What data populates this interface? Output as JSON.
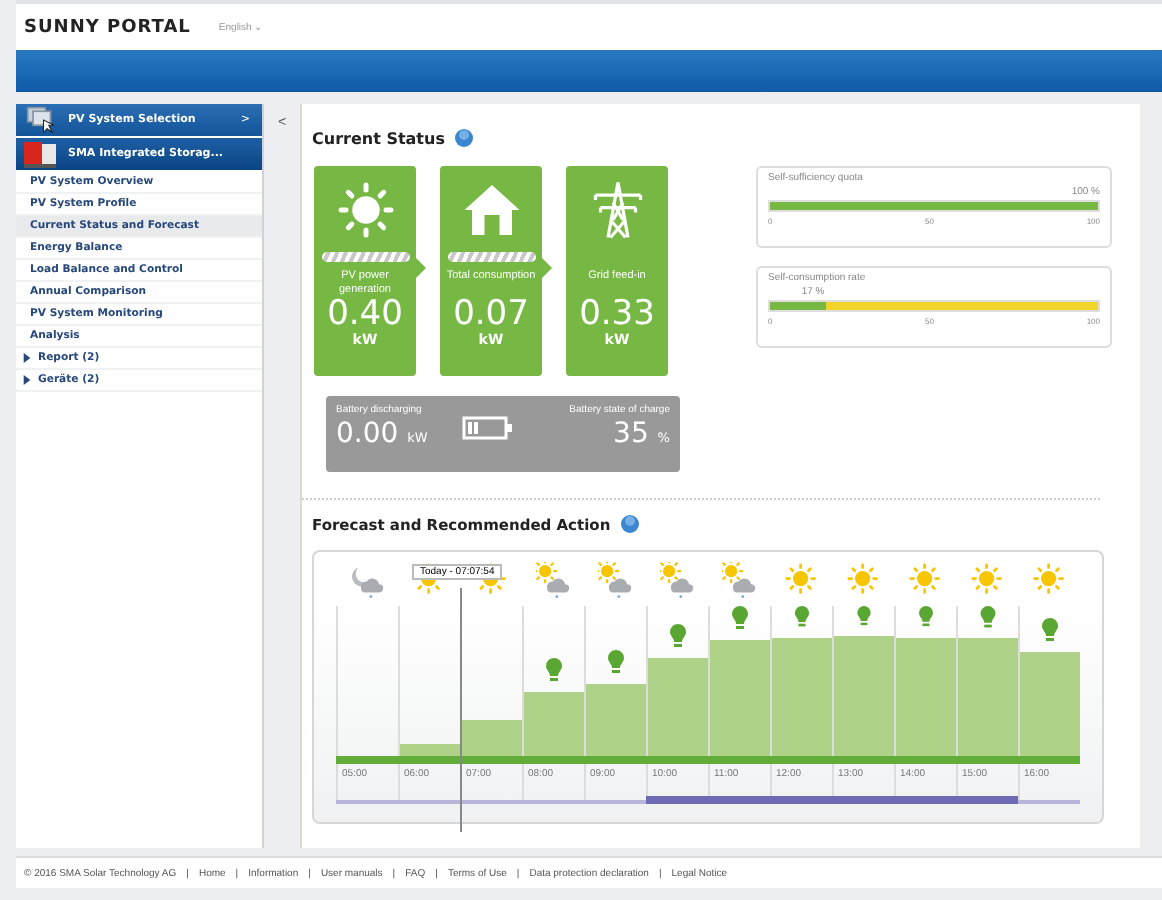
{
  "header": {
    "logo": "SUNNY PORTAL",
    "language": "English ⌄"
  },
  "sidebar": {
    "collapse": "<",
    "sections": [
      {
        "label": "PV System Selection",
        "kind": "selection",
        "selected": false,
        "chevron": ">"
      },
      {
        "label": "SMA Integrated Storag...",
        "kind": "device",
        "selected": true
      }
    ],
    "items": [
      {
        "label": "PV System Overview",
        "selected": false,
        "kind": "link"
      },
      {
        "label": "PV System Profile",
        "selected": false,
        "kind": "link"
      },
      {
        "label": "Current Status and Forecast",
        "selected": true,
        "kind": "link"
      },
      {
        "label": "Energy Balance",
        "selected": false,
        "kind": "link"
      },
      {
        "label": "Load Balance and Control",
        "selected": false,
        "kind": "link"
      },
      {
        "label": "Annual Comparison",
        "selected": false,
        "kind": "link"
      },
      {
        "label": "PV System Monitoring",
        "selected": false,
        "kind": "link"
      },
      {
        "label": "Analysis",
        "selected": false,
        "kind": "link"
      },
      {
        "label": "Report (2)",
        "selected": false,
        "kind": "group",
        "expanded": false
      },
      {
        "label": "Geräte (2)",
        "selected": false,
        "kind": "group",
        "expanded": false
      }
    ]
  },
  "current_status": {
    "title": "Current Status",
    "tiles": [
      {
        "kind": "sun",
        "label": "PV power generation",
        "value": "0.40",
        "unit": "kW",
        "flow": true
      },
      {
        "kind": "house",
        "label": "Total consumption",
        "value": "0.07",
        "unit": "kW",
        "flow": true
      },
      {
        "kind": "pylon",
        "label": "Grid feed-in",
        "value": "0.33",
        "unit": "kW",
        "flow": false
      }
    ],
    "battery": {
      "label": "Battery discharging",
      "value": "0.00",
      "unit": "kW",
      "charge_label": "Battery state of charge",
      "charge": "35",
      "charge_unit": "%"
    },
    "gauges": [
      {
        "title": "Self-sufficiency quota",
        "reading": "100 %",
        "level": 1.0,
        "ticks": [
          "0",
          "50",
          "100"
        ]
      },
      {
        "title": "Self-consumption rate",
        "reading": "17 %",
        "level": 0.17,
        "ticks": [
          "0",
          "50",
          "100"
        ]
      }
    ]
  },
  "forecast": {
    "title": "Forecast and Recommended Action",
    "now_label": "Today - 07:07:54",
    "hours": [
      {
        "time": "05:00",
        "kind": "moon-cloud",
        "recommended": false,
        "now": false,
        "highlighted": false
      },
      {
        "time": "06:00",
        "kind": "sun",
        "recommended": false,
        "now": false,
        "highlighted": false
      },
      {
        "time": "07:00",
        "kind": "sun",
        "recommended": false,
        "now": true,
        "highlighted": false
      },
      {
        "time": "08:00",
        "kind": "sun-cloud",
        "recommended": true,
        "now": false,
        "highlighted": false
      },
      {
        "time": "09:00",
        "kind": "sun-cloud",
        "recommended": true,
        "now": false,
        "highlighted": false
      },
      {
        "time": "10:00",
        "kind": "sun-cloud",
        "recommended": true,
        "now": false,
        "highlighted": true
      },
      {
        "time": "11:00",
        "kind": "sun-cloud",
        "recommended": true,
        "now": false,
        "highlighted": true
      },
      {
        "time": "12:00",
        "kind": "sun",
        "recommended": true,
        "now": false,
        "highlighted": true
      },
      {
        "time": "13:00",
        "kind": "sun",
        "recommended": true,
        "now": false,
        "highlighted": true
      },
      {
        "time": "14:00",
        "kind": "sun",
        "recommended": true,
        "now": false,
        "highlighted": true
      },
      {
        "time": "15:00",
        "kind": "sun",
        "recommended": true,
        "now": false,
        "highlighted": true
      },
      {
        "time": "16:00",
        "kind": "sun",
        "recommended": true,
        "now": false,
        "highlighted": false
      }
    ]
  },
  "footer": {
    "copyright": "© 2016 SMA Solar Technology AG",
    "links": [
      "Home",
      "Information",
      "User manuals",
      "FAQ",
      "Terms of Use",
      "Data protection declaration",
      "Legal Notice"
    ],
    "separator": "|"
  }
}
